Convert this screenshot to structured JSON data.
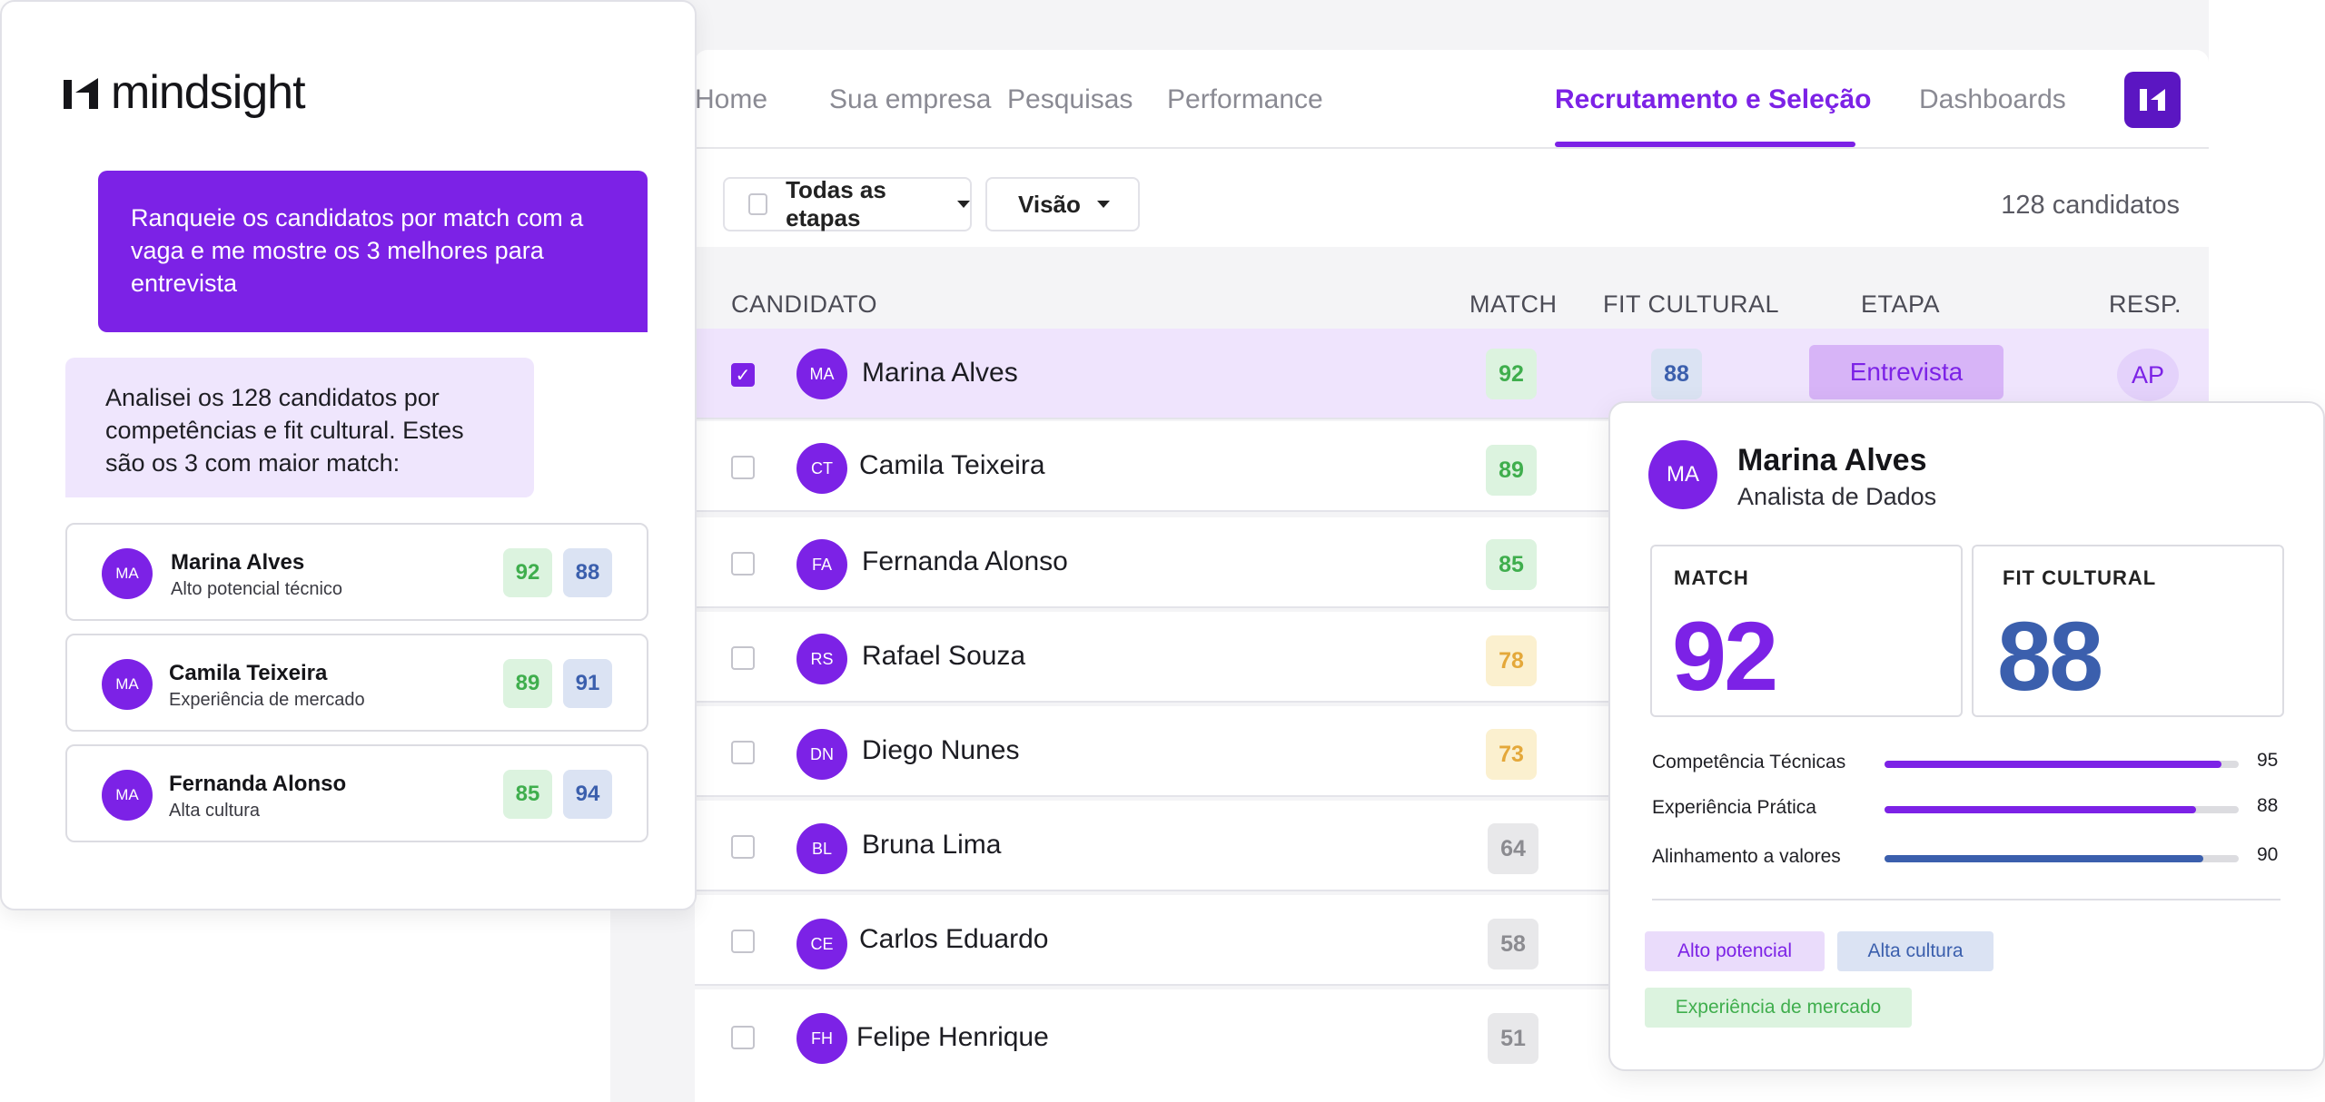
{
  "nav": {
    "items": [
      "Home",
      "Sua empresa",
      "Pesquisas",
      "Performance",
      "Recrutamento e Seleção",
      "Dashboards"
    ],
    "active": "Recrutamento e Seleção"
  },
  "filters": {
    "stage_label": "Todas as etapas",
    "view_label": "Visão",
    "count": "128 candidatos"
  },
  "table": {
    "headers": {
      "candidate": "CANDIDATO",
      "match": "MATCH",
      "fit": "FIT CULTURAL",
      "stage": "ETAPA",
      "resp": "RESP."
    },
    "rows": [
      {
        "initials": "MA",
        "name": "Marina Alves",
        "match": "92",
        "fit": "88",
        "stage": "Entrevista",
        "resp": "AP"
      },
      {
        "initials": "CT",
        "name": "Camila Teixeira",
        "match": "89"
      },
      {
        "initials": "FA",
        "name": "Fernanda Alonso",
        "match": "85"
      },
      {
        "initials": "RS",
        "name": "Rafael Souza",
        "match": "78"
      },
      {
        "initials": "DN",
        "name": "Diego Nunes",
        "match": "73"
      },
      {
        "initials": "BL",
        "name": "Bruna Lima",
        "match": "64"
      },
      {
        "initials": "CE",
        "name": "Carlos Eduardo",
        "match": "58"
      },
      {
        "initials": "FH",
        "name": "Felipe Henrique",
        "match": "51"
      }
    ]
  },
  "chat": {
    "brand": "mindsight",
    "user_message": "Ranqueie os candidatos por match com a vaga e me mostre os 3 melhores para entrevista",
    "ai_message": "Analisei os 128 candidatos por competências e fit cultural. Estes são os 3 com maior match:",
    "cards": [
      {
        "initials": "MA",
        "name": "Marina Alves",
        "subtitle": "Alto potencial técnico",
        "match": "92",
        "fit": "88"
      },
      {
        "initials": "MA",
        "name": "Camila Teixeira",
        "subtitle": "Experiência de mercado",
        "match": "89",
        "fit": "91"
      },
      {
        "initials": "MA",
        "name": "Fernanda Alonso",
        "subtitle": "Alta cultura",
        "match": "85",
        "fit": "94"
      }
    ]
  },
  "detail": {
    "initials": "MA",
    "name": "Marina Alves",
    "role": "Analista de Dados",
    "match_label": "MATCH",
    "match_value": "92",
    "fit_label": "FIT CULTURAL",
    "fit_value": "88",
    "bars": [
      {
        "label": "Competência Técnicas",
        "value": 95,
        "value_text": "95",
        "color": "#7c22e6"
      },
      {
        "label": "Experiência Prática",
        "value": 88,
        "value_text": "88",
        "color": "#7c22e6"
      },
      {
        "label": "Alinhamento a valores",
        "value": 90,
        "value_text": "90",
        "color": "#3b5fad"
      }
    ],
    "tags": [
      "Alto potencial",
      "Alta cultura",
      "Experiência de mercado"
    ]
  },
  "colors": {
    "accent": "#7c22e6",
    "blue": "#3b5fad",
    "green": "#3fae4d",
    "yellow": "#e4a83a",
    "gray": "#8b8b90"
  }
}
